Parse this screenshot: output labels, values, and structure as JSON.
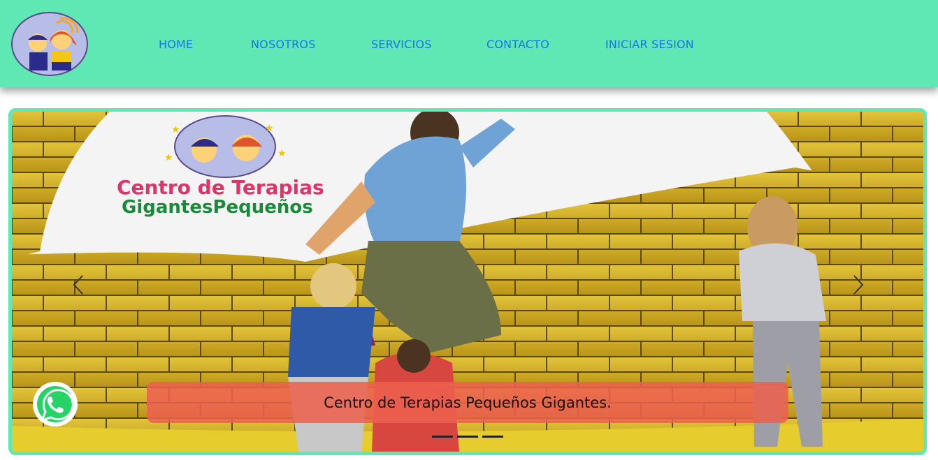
{
  "nav": {
    "logo_alt": "Centro de Terapias logo",
    "items": [
      {
        "label": "HOME"
      },
      {
        "label": "NOSOTROS"
      },
      {
        "label": "SERVICIOS"
      },
      {
        "label": "CONTACTO"
      },
      {
        "label": "INICIAR SESION"
      }
    ]
  },
  "carousel": {
    "logo_line1": "Centro de Terapias",
    "logo_line2": "GigantesPequeños",
    "caption": "Centro de Terapias Pequeños Gigantes.",
    "slide_count": 3,
    "active_slide": 0,
    "prev_icon": "chevron-left-icon",
    "next_icon": "chevron-right-icon"
  },
  "whatsapp": {
    "icon": "whatsapp-icon"
  },
  "colors": {
    "navbar": "#5fe8b3",
    "nav_link": "#1a73e8",
    "caption_bg": "#ec614e",
    "border": "#5fe8b3"
  }
}
